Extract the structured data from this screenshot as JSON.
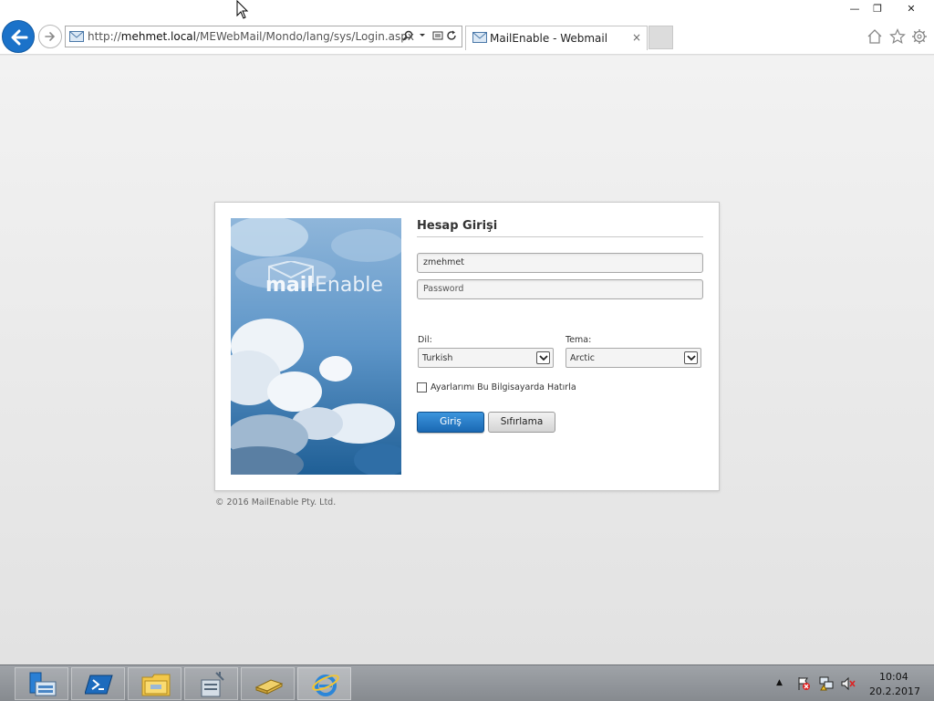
{
  "window": {
    "min_glyph": "—",
    "max_glyph": "❐",
    "close_glyph": "✕"
  },
  "browser": {
    "url_prefix": "http://",
    "url_host": "mehmet.local",
    "url_path": "/MEWebMail/Mondo/lang/sys/Login.aspx",
    "tab_title": "MailEnable - Webmail",
    "tab_close": "×",
    "icons": [
      "back-arrow-icon",
      "forward-arrow-icon",
      "mail-icon",
      "search-icon",
      "dropdown-icon",
      "compatibility-icon",
      "refresh-icon",
      "home-icon",
      "star-icon",
      "gear-icon"
    ]
  },
  "login": {
    "brand_mail": "mail",
    "brand_enable": "Enable",
    "title": "Hesap Girişi",
    "username_value": "zmehmet",
    "password_placeholder": "Password",
    "language_label": "Dil:",
    "language_value": "Turkish",
    "theme_label": "Tema:",
    "theme_value": "Arctic",
    "remember_label": "Ayarlarımı Bu Bilgisayarda Hatırla",
    "remember_checked": false,
    "login_button": "Giriş",
    "reset_button": "Sıfırlama",
    "copyright": "© 2016 MailEnable Pty. Ltd."
  },
  "taskbar": {
    "apps": [
      "server-manager-icon",
      "powershell-icon",
      "file-explorer-icon",
      "admin-tools-icon",
      "books-icon",
      "internet-explorer-icon"
    ],
    "tray_chevron": "▲",
    "time": "10:04",
    "date": "20.2.2017"
  },
  "colors": {
    "accent_blue": "#1a68b3",
    "page_bg": "#ececec",
    "taskbar_bg": "#8f9398"
  }
}
